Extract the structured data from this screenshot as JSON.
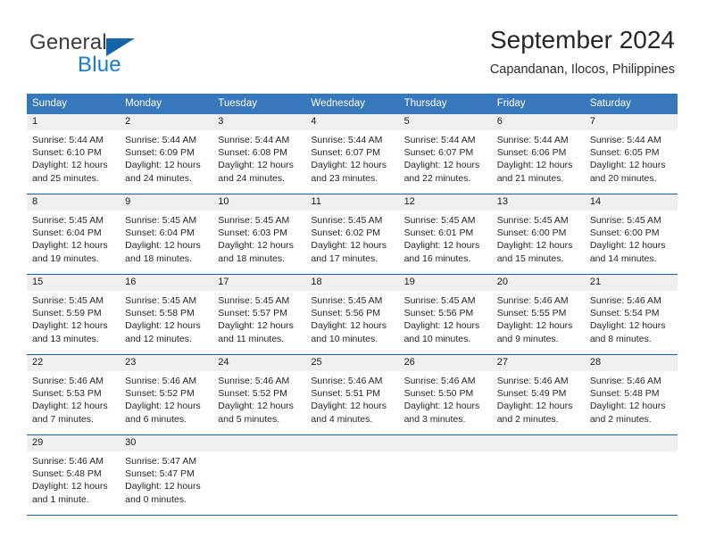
{
  "logo": {
    "word_one": "General",
    "word_two": "Blue",
    "triangle_color": "#1464aa",
    "blue_color": "#1a7cc8"
  },
  "header": {
    "title": "September 2024",
    "subtitle": "Capandanan, Ilocos, Philippines"
  },
  "theme": {
    "header_row_bg": "#3778bd",
    "row_separator": "#1f5fa6",
    "daynum_bg": "#f0f0f0"
  },
  "calendar": {
    "weekday_headers": [
      "Sunday",
      "Monday",
      "Tuesday",
      "Wednesday",
      "Thursday",
      "Friday",
      "Saturday"
    ],
    "weeks": [
      [
        {
          "day": "1",
          "sunrise": "Sunrise: 5:44 AM",
          "sunset": "Sunset: 6:10 PM",
          "daylight_1": "Daylight: 12 hours",
          "daylight_2": "and 25 minutes."
        },
        {
          "day": "2",
          "sunrise": "Sunrise: 5:44 AM",
          "sunset": "Sunset: 6:09 PM",
          "daylight_1": "Daylight: 12 hours",
          "daylight_2": "and 24 minutes."
        },
        {
          "day": "3",
          "sunrise": "Sunrise: 5:44 AM",
          "sunset": "Sunset: 6:08 PM",
          "daylight_1": "Daylight: 12 hours",
          "daylight_2": "and 24 minutes."
        },
        {
          "day": "4",
          "sunrise": "Sunrise: 5:44 AM",
          "sunset": "Sunset: 6:07 PM",
          "daylight_1": "Daylight: 12 hours",
          "daylight_2": "and 23 minutes."
        },
        {
          "day": "5",
          "sunrise": "Sunrise: 5:44 AM",
          "sunset": "Sunset: 6:07 PM",
          "daylight_1": "Daylight: 12 hours",
          "daylight_2": "and 22 minutes."
        },
        {
          "day": "6",
          "sunrise": "Sunrise: 5:44 AM",
          "sunset": "Sunset: 6:06 PM",
          "daylight_1": "Daylight: 12 hours",
          "daylight_2": "and 21 minutes."
        },
        {
          "day": "7",
          "sunrise": "Sunrise: 5:44 AM",
          "sunset": "Sunset: 6:05 PM",
          "daylight_1": "Daylight: 12 hours",
          "daylight_2": "and 20 minutes."
        }
      ],
      [
        {
          "day": "8",
          "sunrise": "Sunrise: 5:45 AM",
          "sunset": "Sunset: 6:04 PM",
          "daylight_1": "Daylight: 12 hours",
          "daylight_2": "and 19 minutes."
        },
        {
          "day": "9",
          "sunrise": "Sunrise: 5:45 AM",
          "sunset": "Sunset: 6:04 PM",
          "daylight_1": "Daylight: 12 hours",
          "daylight_2": "and 18 minutes."
        },
        {
          "day": "10",
          "sunrise": "Sunrise: 5:45 AM",
          "sunset": "Sunset: 6:03 PM",
          "daylight_1": "Daylight: 12 hours",
          "daylight_2": "and 18 minutes."
        },
        {
          "day": "11",
          "sunrise": "Sunrise: 5:45 AM",
          "sunset": "Sunset: 6:02 PM",
          "daylight_1": "Daylight: 12 hours",
          "daylight_2": "and 17 minutes."
        },
        {
          "day": "12",
          "sunrise": "Sunrise: 5:45 AM",
          "sunset": "Sunset: 6:01 PM",
          "daylight_1": "Daylight: 12 hours",
          "daylight_2": "and 16 minutes."
        },
        {
          "day": "13",
          "sunrise": "Sunrise: 5:45 AM",
          "sunset": "Sunset: 6:00 PM",
          "daylight_1": "Daylight: 12 hours",
          "daylight_2": "and 15 minutes."
        },
        {
          "day": "14",
          "sunrise": "Sunrise: 5:45 AM",
          "sunset": "Sunset: 6:00 PM",
          "daylight_1": "Daylight: 12 hours",
          "daylight_2": "and 14 minutes."
        }
      ],
      [
        {
          "day": "15",
          "sunrise": "Sunrise: 5:45 AM",
          "sunset": "Sunset: 5:59 PM",
          "daylight_1": "Daylight: 12 hours",
          "daylight_2": "and 13 minutes."
        },
        {
          "day": "16",
          "sunrise": "Sunrise: 5:45 AM",
          "sunset": "Sunset: 5:58 PM",
          "daylight_1": "Daylight: 12 hours",
          "daylight_2": "and 12 minutes."
        },
        {
          "day": "17",
          "sunrise": "Sunrise: 5:45 AM",
          "sunset": "Sunset: 5:57 PM",
          "daylight_1": "Daylight: 12 hours",
          "daylight_2": "and 11 minutes."
        },
        {
          "day": "18",
          "sunrise": "Sunrise: 5:45 AM",
          "sunset": "Sunset: 5:56 PM",
          "daylight_1": "Daylight: 12 hours",
          "daylight_2": "and 10 minutes."
        },
        {
          "day": "19",
          "sunrise": "Sunrise: 5:45 AM",
          "sunset": "Sunset: 5:56 PM",
          "daylight_1": "Daylight: 12 hours",
          "daylight_2": "and 10 minutes."
        },
        {
          "day": "20",
          "sunrise": "Sunrise: 5:46 AM",
          "sunset": "Sunset: 5:55 PM",
          "daylight_1": "Daylight: 12 hours",
          "daylight_2": "and 9 minutes."
        },
        {
          "day": "21",
          "sunrise": "Sunrise: 5:46 AM",
          "sunset": "Sunset: 5:54 PM",
          "daylight_1": "Daylight: 12 hours",
          "daylight_2": "and 8 minutes."
        }
      ],
      [
        {
          "day": "22",
          "sunrise": "Sunrise: 5:46 AM",
          "sunset": "Sunset: 5:53 PM",
          "daylight_1": "Daylight: 12 hours",
          "daylight_2": "and 7 minutes."
        },
        {
          "day": "23",
          "sunrise": "Sunrise: 5:46 AM",
          "sunset": "Sunset: 5:52 PM",
          "daylight_1": "Daylight: 12 hours",
          "daylight_2": "and 6 minutes."
        },
        {
          "day": "24",
          "sunrise": "Sunrise: 5:46 AM",
          "sunset": "Sunset: 5:52 PM",
          "daylight_1": "Daylight: 12 hours",
          "daylight_2": "and 5 minutes."
        },
        {
          "day": "25",
          "sunrise": "Sunrise: 5:46 AM",
          "sunset": "Sunset: 5:51 PM",
          "daylight_1": "Daylight: 12 hours",
          "daylight_2": "and 4 minutes."
        },
        {
          "day": "26",
          "sunrise": "Sunrise: 5:46 AM",
          "sunset": "Sunset: 5:50 PM",
          "daylight_1": "Daylight: 12 hours",
          "daylight_2": "and 3 minutes."
        },
        {
          "day": "27",
          "sunrise": "Sunrise: 5:46 AM",
          "sunset": "Sunset: 5:49 PM",
          "daylight_1": "Daylight: 12 hours",
          "daylight_2": "and 2 minutes."
        },
        {
          "day": "28",
          "sunrise": "Sunrise: 5:46 AM",
          "sunset": "Sunset: 5:48 PM",
          "daylight_1": "Daylight: 12 hours",
          "daylight_2": "and 2 minutes."
        }
      ],
      [
        {
          "day": "29",
          "sunrise": "Sunrise: 5:46 AM",
          "sunset": "Sunset: 5:48 PM",
          "daylight_1": "Daylight: 12 hours",
          "daylight_2": "and 1 minute."
        },
        {
          "day": "30",
          "sunrise": "Sunrise: 5:47 AM",
          "sunset": "Sunset: 5:47 PM",
          "daylight_1": "Daylight: 12 hours",
          "daylight_2": "and 0 minutes."
        },
        {
          "day": "",
          "sunrise": "",
          "sunset": "",
          "daylight_1": "",
          "daylight_2": ""
        },
        {
          "day": "",
          "sunrise": "",
          "sunset": "",
          "daylight_1": "",
          "daylight_2": ""
        },
        {
          "day": "",
          "sunrise": "",
          "sunset": "",
          "daylight_1": "",
          "daylight_2": ""
        },
        {
          "day": "",
          "sunrise": "",
          "sunset": "",
          "daylight_1": "",
          "daylight_2": ""
        },
        {
          "day": "",
          "sunrise": "",
          "sunset": "",
          "daylight_1": "",
          "daylight_2": ""
        }
      ]
    ]
  }
}
